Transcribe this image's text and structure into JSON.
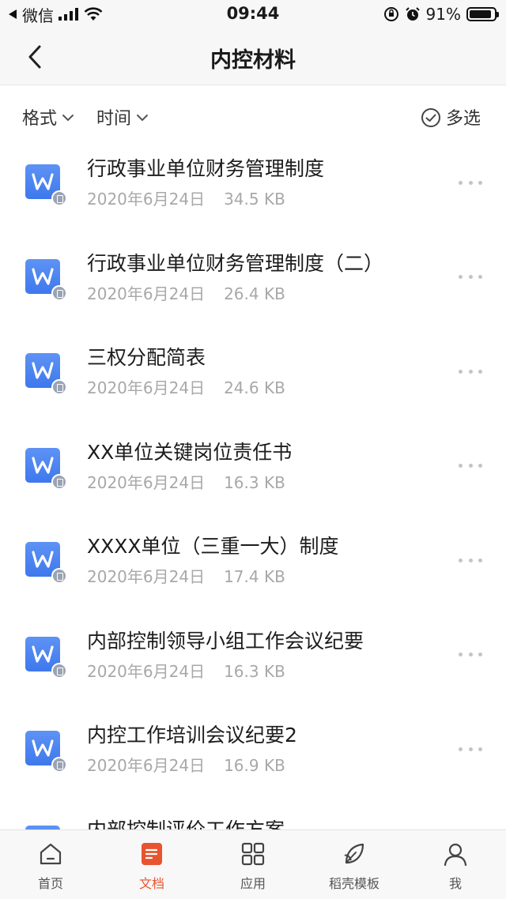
{
  "status_bar": {
    "carrier": "微信",
    "time": "09:44",
    "battery_percent": "91%",
    "battery_level": 0.91
  },
  "nav": {
    "title": "内控材料"
  },
  "filters": {
    "format_label": "格式",
    "time_label": "时间",
    "multiselect_label": "多选"
  },
  "files": [
    {
      "name": "行政事业单位财务管理制度",
      "date": "2020年6月24日",
      "size": "34.5 KB",
      "icon": "word-doc-icon"
    },
    {
      "name": "行政事业单位财务管理制度（二）",
      "date": "2020年6月24日",
      "size": "26.4 KB",
      "icon": "word-doc-icon"
    },
    {
      "name": "三权分配简表",
      "date": "2020年6月24日",
      "size": "24.6 KB",
      "icon": "word-doc-icon"
    },
    {
      "name": "XX单位关键岗位责任书",
      "date": "2020年6月24日",
      "size": "16.3 KB",
      "icon": "word-doc-icon"
    },
    {
      "name": "XXXX单位（三重一大）制度",
      "date": "2020年6月24日",
      "size": "17.4 KB",
      "icon": "word-doc-icon"
    },
    {
      "name": "内部控制领导小组工作会议纪要",
      "date": "2020年6月24日",
      "size": "16.3 KB",
      "icon": "word-doc-icon"
    },
    {
      "name": "内控工作培训会议纪要2",
      "date": "2020年6月24日",
      "size": "16.9 KB",
      "icon": "word-doc-icon"
    },
    {
      "name": "内部控制评价工作方案",
      "date": "",
      "size": "",
      "icon": "word-doc-icon"
    }
  ],
  "tabs": [
    {
      "label": "首页",
      "icon": "home-icon",
      "active": false
    },
    {
      "label": "文档",
      "icon": "document-icon",
      "active": true
    },
    {
      "label": "应用",
      "icon": "apps-grid-icon",
      "active": false
    },
    {
      "label": "稻壳模板",
      "icon": "leaf-icon",
      "active": false
    },
    {
      "label": "我",
      "icon": "profile-icon",
      "active": false
    }
  ],
  "colors": {
    "accent": "#e8542f",
    "word_blue": "#4a82ef",
    "meta_gray": "#a8a8a8"
  }
}
